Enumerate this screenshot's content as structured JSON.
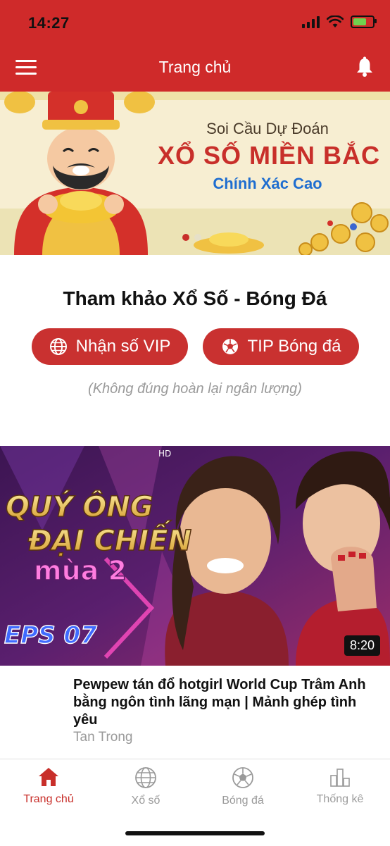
{
  "status": {
    "time": "14:27"
  },
  "header": {
    "title": "Trang chủ"
  },
  "banner": {
    "line1": "Soi Cầu Dự Đoán",
    "line2": "XỔ SỐ MIỀN BẮC",
    "line3": "Chính Xác Cao",
    "slide_count": 2,
    "active_slide": 1
  },
  "section": {
    "title": "Tham khảo Xổ Số - Bóng Đá",
    "vip_button": "Nhận số VIP",
    "tip_button": "TIP Bóng đá",
    "note": "(Không đúng hoàn lại ngân lượng)"
  },
  "video": {
    "show_title": "QUÝ ÔNG ĐẠI CHIẾN",
    "season": "mùa 2",
    "episode": "EPS 07",
    "channel": "HD",
    "duration": "8:20",
    "title": "Pewpew tán đổ hotgirl World Cup Trâm Anh bằng ngôn tình lãng mạn | Mảnh ghép tình yêu",
    "author": "Tan Trong"
  },
  "tabs": [
    {
      "label": "Trang chủ",
      "icon": "home-icon",
      "active": true
    },
    {
      "label": "Xổ số",
      "icon": "globe-icon",
      "active": false
    },
    {
      "label": "Bóng đá",
      "icon": "soccer-ball-icon",
      "active": false
    },
    {
      "label": "Thống kê",
      "icon": "bar-chart-icon",
      "active": false
    }
  ],
  "colors": {
    "brand_red": "#cf2a2a",
    "button_red": "#c93130",
    "muted_gray": "#9a9a9a"
  }
}
